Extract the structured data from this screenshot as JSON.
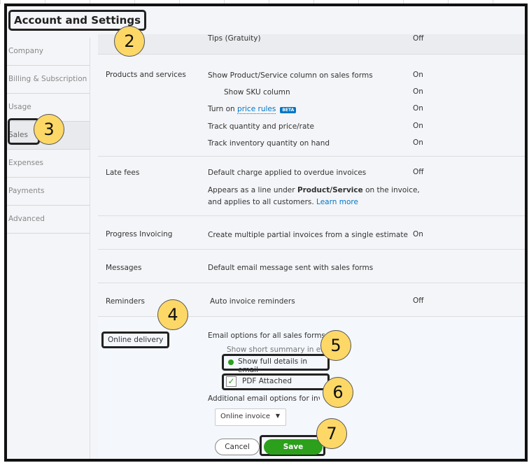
{
  "header": {
    "title": "Account and Settings"
  },
  "sidebar": {
    "items": [
      "Company",
      "Billing & Subscription",
      "Usage",
      "Sales",
      "Expenses",
      "Payments",
      "Advanced"
    ]
  },
  "sections": {
    "tips": {
      "desc": "Tips (Gratuity)",
      "status": "Off"
    },
    "products": {
      "label": "Products and services",
      "rows": [
        {
          "desc": "Show Product/Service column on sales forms",
          "status": "On"
        },
        {
          "desc": "Show SKU column",
          "status": "On"
        },
        {
          "desc": "Turn on",
          "link": "price rules",
          "badge": "BETA",
          "status": "On"
        },
        {
          "desc": "Track quantity and price/rate",
          "status": "On"
        },
        {
          "desc": "Track inventory quantity on hand",
          "status": "On"
        }
      ]
    },
    "late_fees": {
      "label": "Late fees",
      "desc": "Default charge applied to overdue invoices",
      "status": "Off",
      "note_a": "Appears as a line under ",
      "note_bold": "Product/Service",
      "note_b": " on the invoice,",
      "note_c": "and applies to all customers. ",
      "learn_more": "Learn more"
    },
    "progress": {
      "label": "Progress Invoicing",
      "desc": "Create multiple partial invoices from a single estimate",
      "status": "On"
    },
    "messages": {
      "label": "Messages",
      "desc": "Default email message sent with sales forms"
    },
    "reminders": {
      "label": "Reminders",
      "desc": "Auto invoice reminders",
      "status": "Off"
    },
    "online": {
      "label": "Online delivery",
      "email_options": "Email options for all sales forms",
      "radio_short": "Show short summary in email",
      "radio_full": "Show full details in email",
      "pdf": "PDF Attached",
      "additional": "Additional email options for invoices",
      "select": "Online invoice"
    }
  },
  "buttons": {
    "cancel": "Cancel",
    "save": "Save"
  },
  "annotations": [
    "2",
    "3",
    "4",
    "5",
    "6",
    "7"
  ],
  "colors": {
    "accent": "#2ca01c",
    "link": "#0077c5"
  }
}
